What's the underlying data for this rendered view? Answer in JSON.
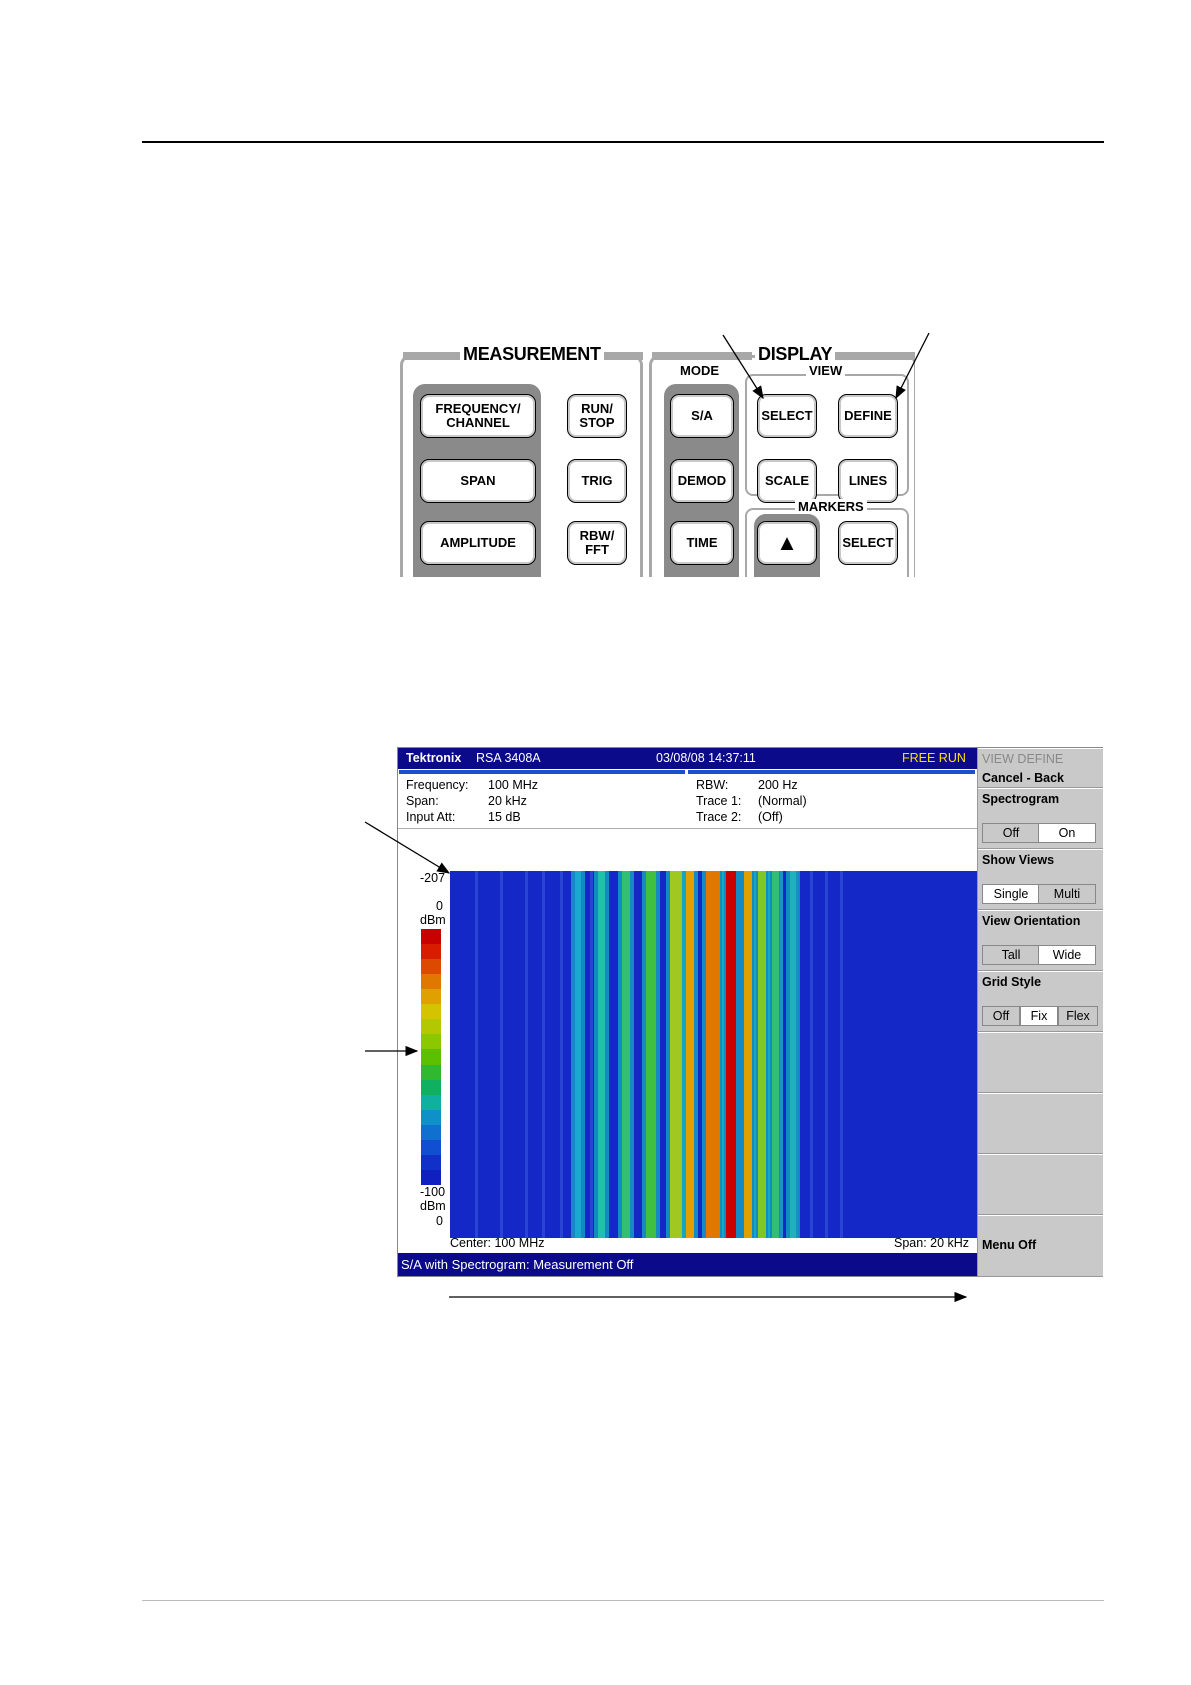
{
  "panel": {
    "measurement_title": "MEASUREMENT",
    "display_title": "DISPLAY",
    "mode_label": "MODE",
    "view_label": "VIEW",
    "markers_label": "MARKERS",
    "keys": {
      "frequency": "FREQUENCY/ CHANNEL",
      "run_stop": "RUN/ STOP",
      "span": "SPAN",
      "trig": "TRIG",
      "amplitude": "AMPLITUDE",
      "rbw_fft": "RBW/ FFT",
      "sa": "S/A",
      "demod": "DEMOD",
      "time": "TIME",
      "view_select": "SELECT",
      "define": "DEFINE",
      "scale": "SCALE",
      "lines": "LINES",
      "marker_up": "▲",
      "marker_select": "SELECT"
    }
  },
  "screen": {
    "brand": "Tektronix",
    "model": "RSA 3408A",
    "datetime": "03/08/08 14:37:11",
    "run_state": "FREE RUN",
    "info": {
      "frequency_label": "Frequency:",
      "frequency_value": "100 MHz",
      "span_label": "Span:",
      "span_value": "20 kHz",
      "input_att_label": "Input Att:",
      "input_att_value": "15 dB",
      "rbw_label": "RBW:",
      "rbw_value": "200 Hz",
      "trace1_label": "Trace 1:",
      "trace1_value": "(Normal)",
      "trace2_label": "Trace 2:",
      "trace2_value": "(Off)"
    },
    "plot": {
      "frame_top": "-207",
      "scale_top": "0",
      "scale_unit_top": "dBm",
      "scale_bottom": "-100",
      "scale_unit_bottom": "dBm",
      "frame_bottom": "0",
      "center": "Center: 100 MHz",
      "span": "Span: 20 kHz"
    },
    "status": "S/A with Spectrogram: Measurement Off",
    "colors": {
      "background": "#1428c8",
      "scale": [
        "#c80000",
        "#d81c00",
        "#dc4a00",
        "#e07800",
        "#e0a000",
        "#d4c400",
        "#b4c800",
        "#8cc800",
        "#5cc000",
        "#30b830",
        "#10b060",
        "#10b0a0",
        "#1090c8",
        "#1070d0",
        "#1050d0",
        "#1030c8",
        "#1020c0"
      ]
    }
  },
  "menu": {
    "title": "VIEW DEFINE",
    "cancel": "Cancel - Back",
    "spectrogram": {
      "label": "Spectrogram",
      "options": [
        "Off",
        "On"
      ],
      "selected": "On"
    },
    "show_views": {
      "label": "Show Views",
      "options": [
        "Single",
        "Multi"
      ],
      "selected": "Single"
    },
    "orientation": {
      "label": "View Orientation",
      "options": [
        "Tall",
        "Wide"
      ],
      "selected": "Wide"
    },
    "grid_style": {
      "label": "Grid Style",
      "options": [
        "Off",
        "Fix",
        "Flex"
      ],
      "selected": "Fix"
    },
    "menu_off": "Menu Off"
  }
}
